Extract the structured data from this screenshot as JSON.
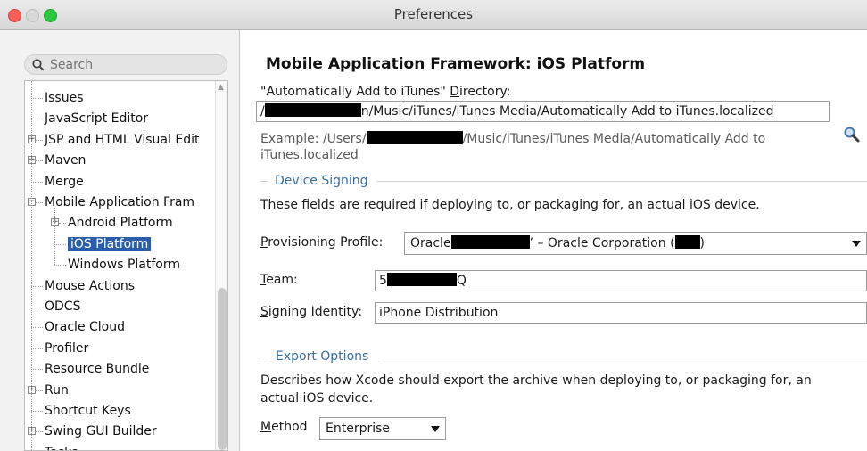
{
  "window": {
    "title": "Preferences"
  },
  "search": {
    "placeholder": "Search"
  },
  "tree": {
    "items": [
      {
        "label": "Issues",
        "expandable": false,
        "level": 0
      },
      {
        "label": "JavaScript Editor",
        "expandable": false,
        "level": 0
      },
      {
        "label": "JSP and HTML Visual Edit",
        "expandable": true,
        "level": 0
      },
      {
        "label": "Maven",
        "expandable": true,
        "level": 0
      },
      {
        "label": "Merge",
        "expandable": false,
        "level": 0
      },
      {
        "label": "Mobile Application Fram",
        "expandable": true,
        "expanded": true,
        "level": 0
      },
      {
        "label": "Android Platform",
        "expandable": true,
        "level": 1
      },
      {
        "label": "iOS Platform",
        "expandable": false,
        "level": 1,
        "selected": true
      },
      {
        "label": "Windows Platform",
        "expandable": false,
        "level": 1
      },
      {
        "label": "Mouse Actions",
        "expandable": false,
        "level": 0
      },
      {
        "label": "ODCS",
        "expandable": false,
        "level": 0
      },
      {
        "label": "Oracle Cloud",
        "expandable": false,
        "level": 0
      },
      {
        "label": "Profiler",
        "expandable": false,
        "level": 0
      },
      {
        "label": "Resource Bundle",
        "expandable": false,
        "level": 0
      },
      {
        "label": "Run",
        "expandable": true,
        "level": 0
      },
      {
        "label": "Shortcut Keys",
        "expandable": false,
        "level": 0
      },
      {
        "label": "Swing GUI Builder",
        "expandable": true,
        "level": 0
      },
      {
        "label": "Tasks",
        "expandable": false,
        "level": 0
      }
    ]
  },
  "main": {
    "heading": "Mobile Application Framework: iOS Platform",
    "itunes_label_prefix": "\"Automatically Add to iTunes\" ",
    "itunes_label_mnemonic": "D",
    "itunes_label_rest": "irectory:",
    "itunes_path_start": "/",
    "itunes_path_end": "n/Music/iTunes/iTunes Media/Automatically Add to iTunes.localized",
    "example_start": "Example: /Users/",
    "example_end": "/Music/iTunes/iTunes Media/Automatically Add to",
    "example_line2": "iTunes.localized",
    "device_signing_title": "Device Signing",
    "device_signing_desc": "These fields are required if deploying to, or packaging for, an actual iOS device.",
    "provisioning_mnemonic": "P",
    "provisioning_rest": "rovisioning Profile:",
    "provisioning_value_a": "Oracle",
    "provisioning_value_b": "’  –  Oracle Corporation (",
    "provisioning_value_c": ")",
    "team_mnemonic": "T",
    "team_rest": "eam:",
    "team_value_a": "5",
    "team_value_b": "Q",
    "signing_mnemonic": "S",
    "signing_rest": "igning Identity:",
    "signing_value": "iPhone Distribution",
    "export_title": "Export Options",
    "export_desc_1": "Describes how Xcode should export the archive when deploying to, or packaging for, an",
    "export_desc_2": "actual iOS device.",
    "method_mnemonic": "M",
    "method_rest": "ethod",
    "method_value": "Enterprise"
  }
}
